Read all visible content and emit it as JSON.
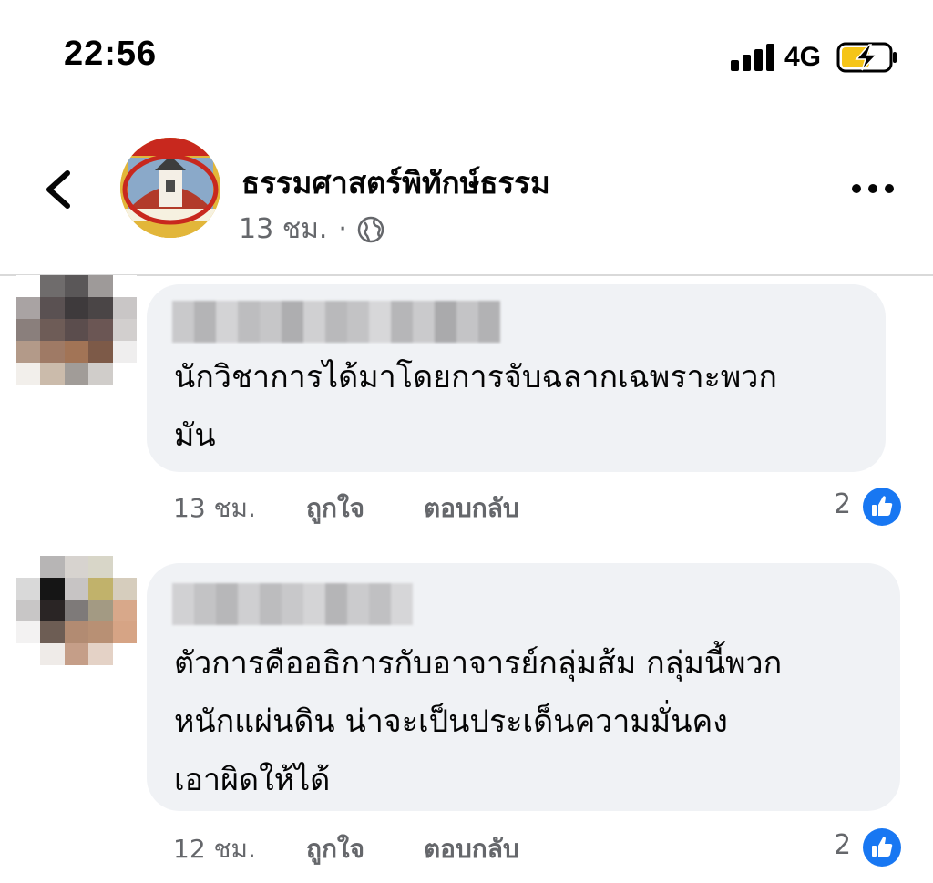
{
  "status_bar": {
    "time": "22:56",
    "network": "4G"
  },
  "post": {
    "page_name": "ธรรมศาสตร์พิทักษ์ธรรม",
    "time_ago": "13 ชม.",
    "separator": "·",
    "privacy_icon": "globe-icon"
  },
  "comments": [
    {
      "text": "นักวิชาการได้มาโดยการจับฉลากเฉพราะพวก\nมัน",
      "time_ago": "13 ชม.",
      "like_label": "ถูกใจ",
      "reply_label": "ตอบกลับ",
      "like_count": "2"
    },
    {
      "text": "ตัวการคืออธิการกับอาจารย์กลุ่มส้ม กลุ่มนี้พวก\nหนักแผ่นดิน น่าจะเป็นประเด็นความมั่นคง\nเอาผิดให้ได้",
      "time_ago": "12 ชม.",
      "like_label": "ถูกใจ",
      "reply_label": "ตอบกลับ",
      "like_count": "2"
    }
  ],
  "colors": {
    "facebook_blue": "#1877f2",
    "bubble_bg": "#f0f2f5",
    "secondary_text": "#65676b",
    "battery_charging": "#f5c518"
  }
}
